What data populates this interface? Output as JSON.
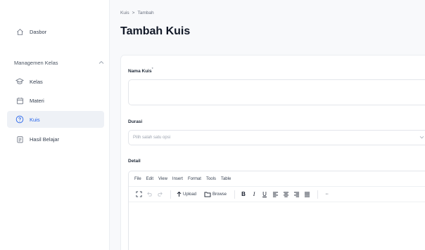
{
  "sidebar": {
    "dashboard": {
      "label": "Dasbor",
      "icon": "home-icon"
    },
    "section": {
      "label": "Managemen Kelas",
      "icon": "chevron-up-icon"
    },
    "items": [
      {
        "label": "Kelas",
        "icon": "graduation-cap-icon"
      },
      {
        "label": "Materi",
        "icon": "calendar-icon"
      },
      {
        "label": "Kuis",
        "icon": "help-circle-icon",
        "active": true
      },
      {
        "label": "Hasil Belajar",
        "icon": "clipboard-icon"
      }
    ]
  },
  "breadcrumb": {
    "parent": "Kuis",
    "separator": ">",
    "current": "Tambah"
  },
  "page": {
    "title": "Tambah Kuis"
  },
  "form": {
    "name": {
      "label": "Nama Kuis",
      "required_mark": "*",
      "value": ""
    },
    "duration": {
      "label": "Durasi",
      "placeholder": "Pilih salah satu opsi"
    },
    "detail": {
      "label": "Detail"
    }
  },
  "editor": {
    "menus": [
      "File",
      "Edit",
      "View",
      "Insert",
      "Format",
      "Tools",
      "Table"
    ],
    "toolbar": {
      "upload": "Upload",
      "browse": "Browse",
      "bold": "B",
      "italic": "I",
      "underline": "U",
      "more": "···"
    }
  },
  "colors": {
    "accent": "#2563eb",
    "active_bg": "#eef1f6",
    "border": "#e3e6eb"
  }
}
